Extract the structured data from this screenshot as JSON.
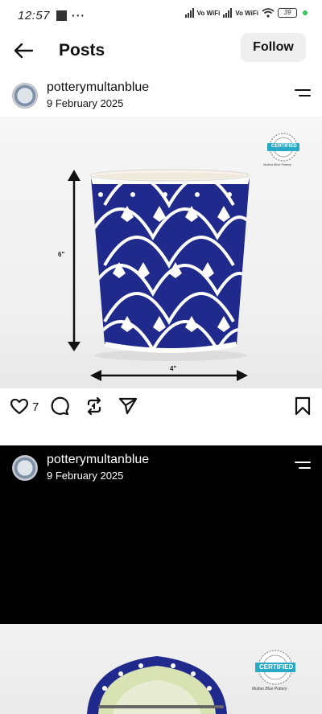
{
  "status_bar": {
    "time": "12:57",
    "more": "···",
    "network1": "Vo WiFi",
    "network2": "Vo WiFi",
    "battery": "39"
  },
  "header": {
    "title": "Posts",
    "follow_label": "Follow"
  },
  "posts": [
    {
      "username": "potterymultanblue",
      "date": "9 February 2025",
      "image": {
        "height_label": "6\"",
        "width_label": "4\"",
        "badge_text": "CERTIFIED",
        "badge_caption": "Multan Blue Pottery"
      },
      "likes": "7"
    },
    {
      "username": "potterymultanblue",
      "date": "9 February 2025"
    }
  ],
  "next_image": {
    "badge_text": "CERTIFIED",
    "badge_caption": "Multan Blue Pottery"
  },
  "icons": {
    "back": "arrow-left-icon",
    "menu": "menu-icon",
    "like": "heart-icon",
    "comment": "comment-icon",
    "repost": "repost-icon",
    "share": "send-icon",
    "save": "bookmark-icon"
  },
  "colors": {
    "pottery_blue": "#1f2a8c",
    "badge_teal": "#2aa9c6",
    "follow_bg": "#efefef"
  }
}
